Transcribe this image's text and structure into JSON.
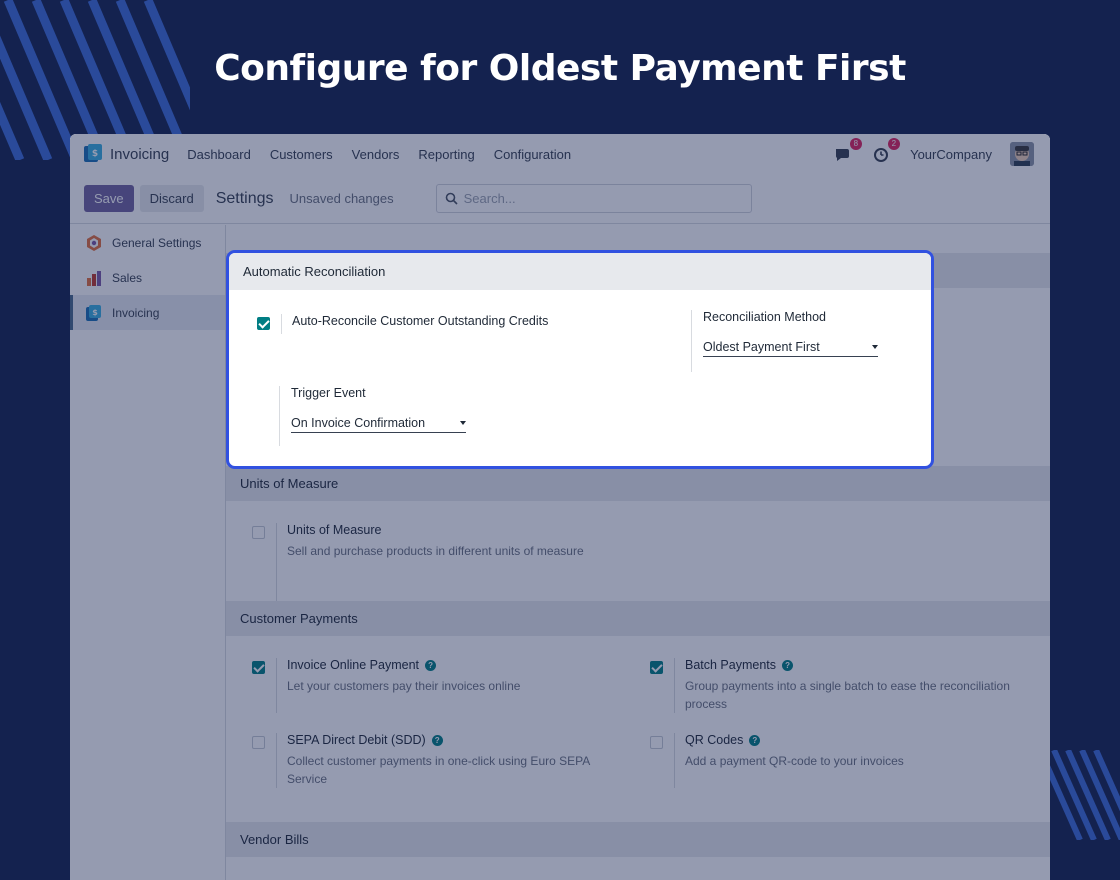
{
  "page_title": "Configure for Oldest Payment First",
  "navbar": {
    "app_name": "Invoicing",
    "menu": [
      "Dashboard",
      "Customers",
      "Vendors",
      "Reporting",
      "Configuration"
    ],
    "messages_count": "8",
    "activities_count": "2",
    "company": "YourCompany"
  },
  "controlbar": {
    "save_label": "Save",
    "discard_label": "Discard",
    "title": "Settings",
    "status": "Unsaved changes",
    "search_placeholder": "Search..."
  },
  "sidebar": {
    "items": [
      {
        "label": "General Settings",
        "icon": "general-settings-icon"
      },
      {
        "label": "Sales",
        "icon": "sales-icon"
      },
      {
        "label": "Invoicing",
        "icon": "invoicing-icon",
        "active": true
      }
    ]
  },
  "auto_reconcile": {
    "section_title": "Automatic Reconciliation",
    "checkbox_label": "Auto-Reconcile Customer Outstanding Credits",
    "checked": true,
    "method_label": "Reconciliation Method",
    "method_value": "Oldest Payment First",
    "trigger_label": "Trigger Event",
    "trigger_value": "On Invoice Confirmation"
  },
  "uom": {
    "section_title": "Units of Measure",
    "label": "Units of Measure",
    "desc": "Sell and purchase products in different units of measure",
    "checked": false
  },
  "customer_payments": {
    "section_title": "Customer Payments",
    "items": [
      {
        "label": "Invoice Online Payment",
        "desc": "Let your customers pay their invoices online",
        "checked": true
      },
      {
        "label": "Batch Payments",
        "desc": "Group payments into a single batch to ease the reconciliation process",
        "checked": true
      },
      {
        "label": "SEPA Direct Debit (SDD)",
        "desc": "Collect customer payments in one-click using Euro SEPA Service",
        "checked": false
      },
      {
        "label": "QR Codes",
        "desc": "Add a payment QR-code to your invoices",
        "checked": false
      }
    ]
  },
  "vendor_bills": {
    "section_title": "Vendor Bills"
  },
  "colors": {
    "background": "#14224f",
    "highlight_border": "#3151e0",
    "primary": "#71639e",
    "checkbox": "#017e84"
  }
}
